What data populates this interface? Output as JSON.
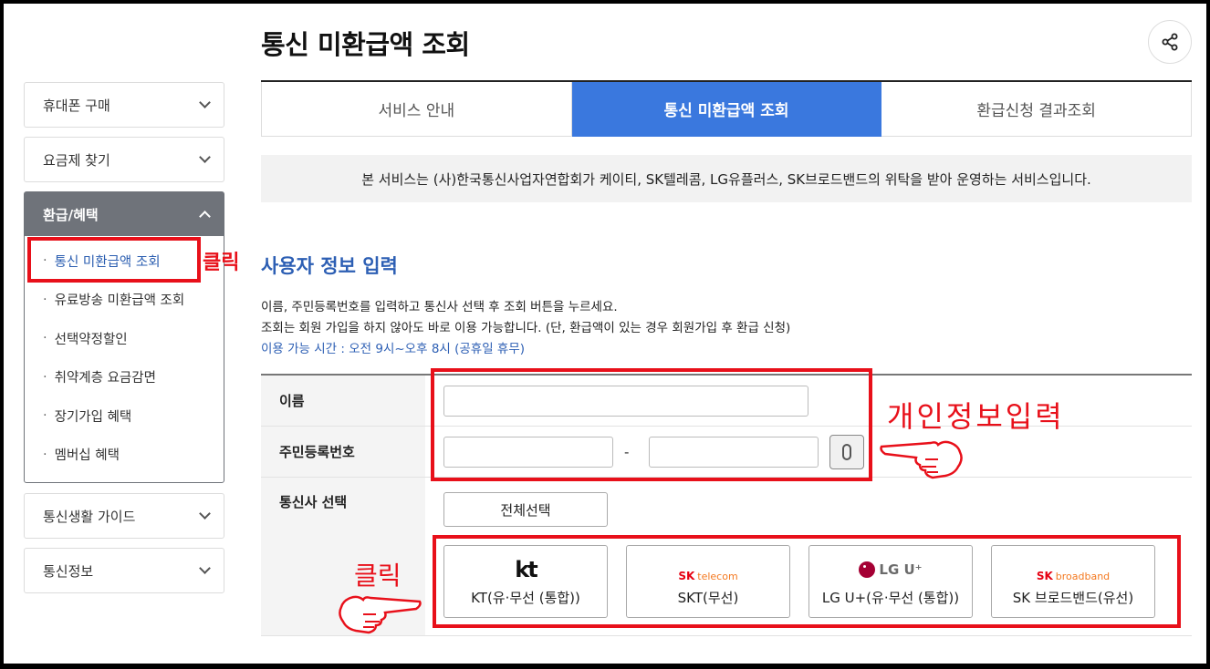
{
  "page": {
    "title": "통신 미환급액 조회"
  },
  "sidebar": {
    "top_menus": [
      "휴대폰 구매",
      "요금제 찾기"
    ],
    "active_menu": "환급/혜택",
    "sub_items": [
      "통신 미환급액 조회",
      "유료방송 미환급액 조회",
      "선택약정할인",
      "취약계층 요금감면",
      "장기가입 혜택",
      "멤버십 혜택"
    ],
    "bottom_menus": [
      "통신생활 가이드",
      "통신정보"
    ]
  },
  "tabs": [
    "서비스 안내",
    "통신 미환급액 조회",
    "환급신청 결과조회"
  ],
  "notice": "본 서비스는 (사)한국통신사업자연합회가 케이티, SK텔레콤, LG유플러스, SK브로드밴드의 위탁을 받아 운영하는 서비스입니다.",
  "section": {
    "title": "사용자 정보 입력",
    "line1": "이름, 주민등록번호를 입력하고 통신사 선택 후 조회 버튼을 누르세요.",
    "line2": "조회는 회원 가입을 하지 않아도 바로 이용 가능합니다. (단, 환급액이 있는 경우 회원가입 후 환급 신청)",
    "hours": "이용 가능 시간 : 오전 9시~오후 8시 (공휴일 휴무)"
  },
  "form": {
    "name_label": "이름",
    "name_value": "",
    "rrn_label": "주민등록번호",
    "rrn_front_value": "",
    "rrn_back_value": "",
    "rrn_separator": "-",
    "carrier_label": "통신사 선택",
    "select_all": "전체선택",
    "carriers": [
      {
        "logo": "kt",
        "label": "KT(유·무선 (통합))"
      },
      {
        "logo": "SK",
        "logo_sub": "telecom",
        "label": "SKT(무선)"
      },
      {
        "logo": "LG U⁺",
        "label": "LG U+(유·무선 (통합))"
      },
      {
        "logo": "SK",
        "logo_sub": "broadband",
        "label": "SK 브로드밴드(유선)"
      }
    ]
  },
  "annotations": {
    "click1": "클릭",
    "personal_info": "개인정보입력",
    "click2": "클릭"
  },
  "colors": {
    "accent": "#3a78de",
    "annotation": "#e8101a",
    "title_blue": "#2d5fb4",
    "sidebar_active": "#6f737a"
  },
  "icons": {
    "share": "share-icon",
    "chevron": "chevron-icon",
    "keyboard": "secure-keyboard-icon",
    "hand": "pointing-hand-icon"
  }
}
